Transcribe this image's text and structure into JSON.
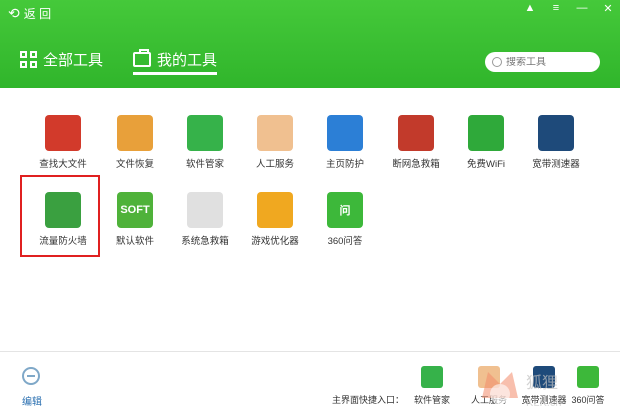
{
  "header": {
    "back_label": "返 回",
    "tabs": [
      {
        "label": "全部工具"
      },
      {
        "label": "我的工具"
      }
    ],
    "search_placeholder": "搜索工具",
    "window_controls": [
      "skin-icon",
      "menu-icon",
      "minimize-icon",
      "close-icon"
    ]
  },
  "tools": [
    {
      "label": "查找大文件",
      "icon": "gb-file-icon",
      "color": "#d23a2b"
    },
    {
      "label": "文件恢复",
      "icon": "folder-restore-icon",
      "color": "#e8a03a"
    },
    {
      "label": "软件管家",
      "icon": "software-manager-icon",
      "color": "#36b24a"
    },
    {
      "label": "人工服务",
      "icon": "doctor-icon",
      "color": "#f0c090"
    },
    {
      "label": "主页防护",
      "icon": "home-shield-icon",
      "color": "#2c7fd6"
    },
    {
      "label": "断网急救箱",
      "icon": "first-aid-box-icon",
      "color": "#c23a2b"
    },
    {
      "label": "免费WiFi",
      "icon": "wifi-icon",
      "color": "#2fa93a"
    },
    {
      "label": "宽带测速器",
      "icon": "speedometer-icon",
      "color": "#1e4a7a"
    },
    {
      "label": "流量防火墙",
      "icon": "traffic-firewall-icon",
      "color": "#3aa040"
    },
    {
      "label": "默认软件",
      "icon": "soft-default-icon",
      "color": "#4fb23a",
      "text": "SOFT"
    },
    {
      "label": "系统急救箱",
      "icon": "system-aid-icon",
      "color": "#e0e0e0"
    },
    {
      "label": "游戏优化器",
      "icon": "game-optimizer-icon",
      "color": "#f0a820"
    },
    {
      "label": "360问答",
      "icon": "qa-icon",
      "color": "#3db83a",
      "text": "问"
    }
  ],
  "footer": {
    "edit_label": "编辑",
    "quick_label": "主界面快捷入口：",
    "quick_items": [
      {
        "label": "软件管家",
        "color": "#36b24a"
      },
      {
        "label": "人工服务",
        "color": "#f0c090"
      },
      {
        "label": "宽带测速器",
        "color": "#1e4a7a"
      },
      {
        "label": "360问答",
        "color": "#3db83a"
      }
    ]
  },
  "watermark": {
    "text": "狐狸"
  }
}
